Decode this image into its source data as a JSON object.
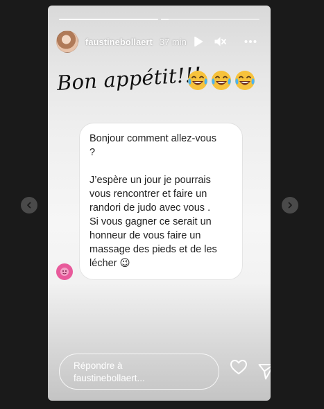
{
  "story": {
    "progress": [
      1.0,
      0.08
    ],
    "username": "faustinebollaert",
    "time": "37 min",
    "icons": {
      "play": "play-icon",
      "mute": "mute-icon",
      "more": "more-icon"
    }
  },
  "content": {
    "title": "Bon appétit!!!",
    "emojis": [
      "laughing-tears-emoji",
      "laughing-tears-emoji",
      "laughing-tears-emoji"
    ],
    "message": {
      "line1": "Bonjour comment allez-vous\n?",
      "line2": "J’espère un jour je pourrais\nvous rencontrer et faire un\nrandori de judo avec vous .\nSi vous gagner ce serait un\nhonneur de vous faire un\nmassage des pieds et de les\nlécher 😉"
    }
  },
  "reply": {
    "label_line1": "Répondre à",
    "label_line2": "faustinebollaert..."
  },
  "colors": {
    "background": "#1a1a1a",
    "bubble": "#ffffff",
    "text": "#222222"
  }
}
